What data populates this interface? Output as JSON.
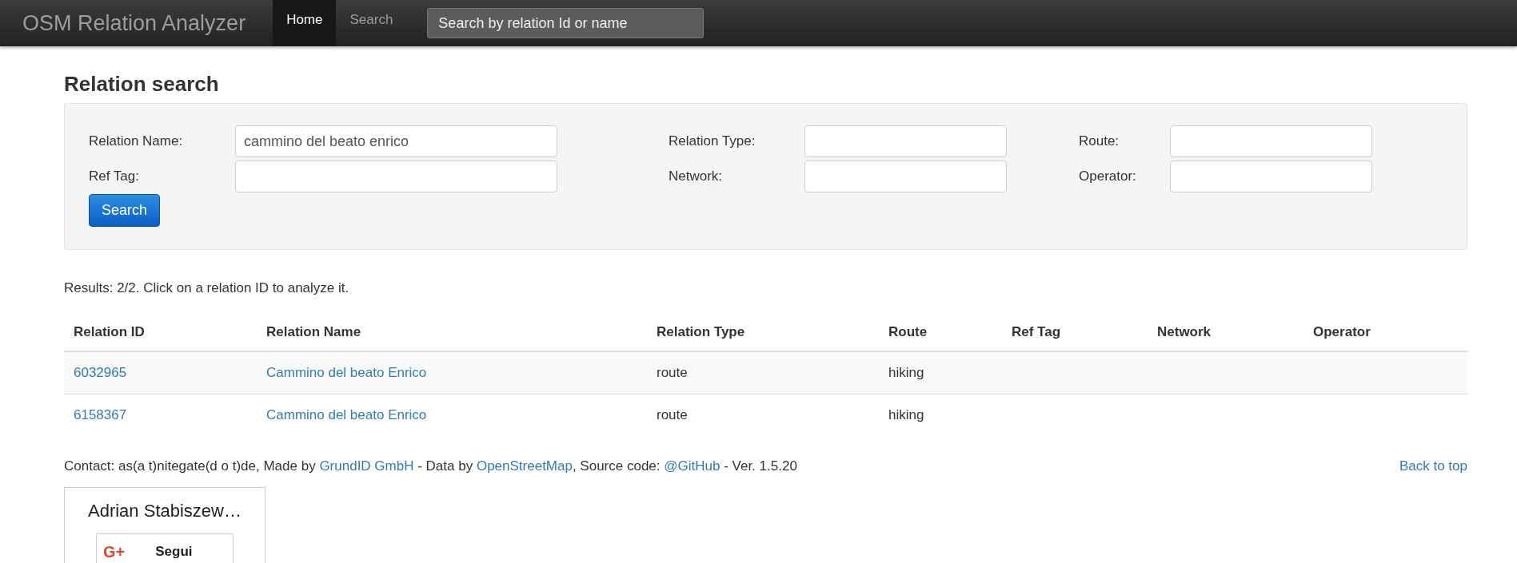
{
  "navbar": {
    "brand": "OSM Relation Analyzer",
    "links": [
      {
        "label": "Home",
        "selected": true
      },
      {
        "label": "Search",
        "selected": false
      }
    ],
    "search": {
      "placeholder": "Search by relation Id or name"
    }
  },
  "heading": "Relation search",
  "form": {
    "fields": [
      {
        "label": "Relation Name:",
        "value": "cammino del beato enrico"
      },
      {
        "label": "Relation Type:"
      },
      {
        "label": "Route:"
      },
      {
        "label": "Ref Tag:"
      },
      {
        "label": "Network:"
      },
      {
        "label": "Operator:"
      }
    ],
    "button": "Search"
  },
  "results_text": "Results: 2/2. Click on a relation ID to analyze it.",
  "table": {
    "columns": [
      "Relation ID",
      "Relation Name",
      "Relation Type",
      "Route",
      "Ref Tag",
      "Network",
      "Operator"
    ],
    "rows": [
      [
        "6032965",
        "Cammino del beato Enrico",
        "route",
        "hiking",
        null,
        null,
        null
      ],
      [
        "6158367",
        "Cammino del beato Enrico",
        "route",
        "hiking",
        null,
        null,
        null
      ]
    ]
  },
  "footer": {
    "parts": [
      {
        "kind": "text",
        "text": "Contact: as(a t)nitegate(d o t)de, Made by "
      },
      {
        "kind": "link",
        "text": "GrundID GmbH"
      },
      {
        "kind": "text",
        "text": " - Data by "
      },
      {
        "kind": "link",
        "text": "OpenStreetMap"
      },
      {
        "kind": "text",
        "text": ", Source code: "
      },
      {
        "kind": "link",
        "text": "@GitHub"
      },
      {
        "kind": "text",
        "text": " - Ver. 1.5.20"
      }
    ],
    "back_to_top": "Back to top"
  },
  "profile_widget": {
    "name": "Adrian Stabiszew…",
    "logo": "G+",
    "button": "Segui"
  }
}
